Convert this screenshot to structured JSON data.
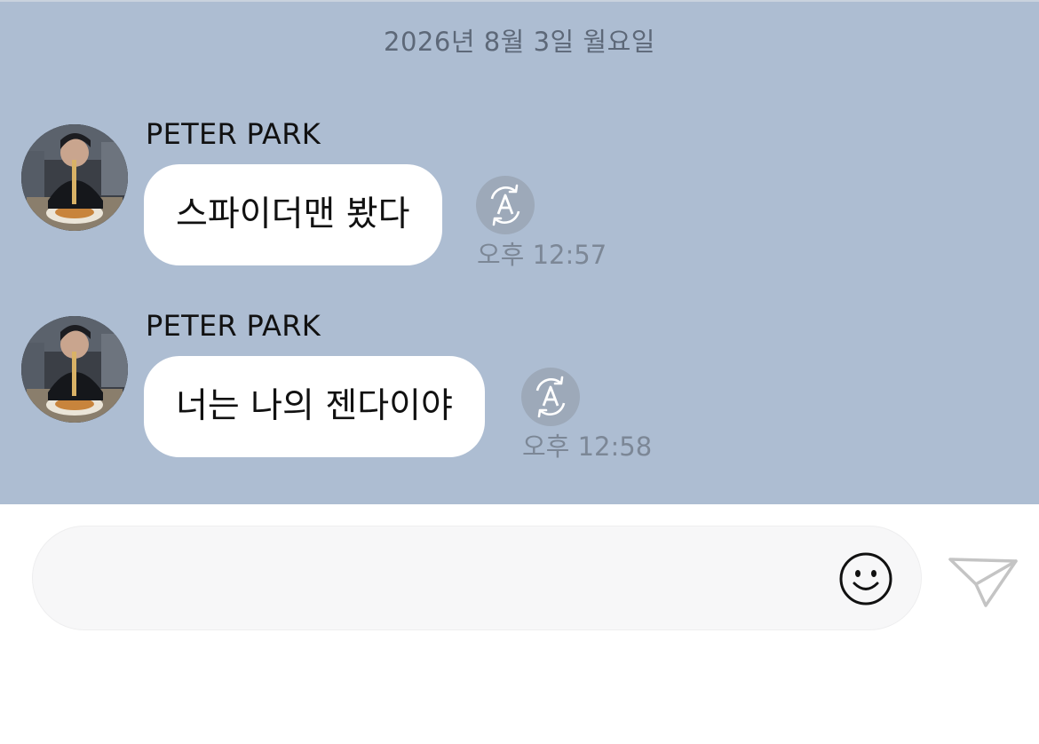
{
  "chat": {
    "date": "2026년 8월 3일 월요일",
    "messages": [
      {
        "sender": "PETER PARK",
        "text": "스파이더맨 봤다",
        "time": "오후 12:57",
        "translate_icon": "translate-a-icon"
      },
      {
        "sender": "PETER PARK",
        "text": "너는 나의 젠다이야",
        "time": "오후 12:58",
        "translate_icon": "translate-a-icon"
      }
    ]
  },
  "composer": {
    "placeholder": "",
    "value": "",
    "emoji_icon": "smiley-face-icon",
    "send_icon": "paper-plane-icon"
  },
  "colors": {
    "chat_background": "#adbdd2",
    "bubble": "#ffffff",
    "translate_button": "#9da9b9",
    "composer_background": "#f7f7f8"
  }
}
